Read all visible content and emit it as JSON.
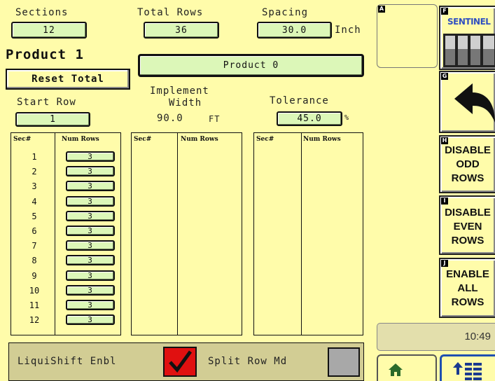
{
  "top": {
    "sections_label": "Sections",
    "sections_value": "12",
    "total_rows_label": "Total Rows",
    "total_rows_value": "36",
    "spacing_label": "Spacing",
    "spacing_value": "30.0",
    "spacing_unit": "Inch"
  },
  "product": {
    "title": "Product 1",
    "selector_value": "Product 0",
    "reset_label": "Reset Total"
  },
  "start_row": {
    "label": "Start Row",
    "value": "1"
  },
  "implement": {
    "label_line1": "Implement",
    "label_line2": "Width",
    "value": "90.0",
    "unit": "FT"
  },
  "tolerance": {
    "label": "Tolerance",
    "value": "45.0",
    "unit": "%"
  },
  "table": {
    "col_sec": "Sec#",
    "col_rows": "Num Rows",
    "rows": [
      {
        "sec": "1",
        "rows": "3"
      },
      {
        "sec": "2",
        "rows": "3"
      },
      {
        "sec": "3",
        "rows": "3"
      },
      {
        "sec": "4",
        "rows": "3"
      },
      {
        "sec": "5",
        "rows": "3"
      },
      {
        "sec": "6",
        "rows": "3"
      },
      {
        "sec": "7",
        "rows": "3"
      },
      {
        "sec": "8",
        "rows": "3"
      },
      {
        "sec": "9",
        "rows": "3"
      },
      {
        "sec": "10",
        "rows": "3"
      },
      {
        "sec": "11",
        "rows": "3"
      },
      {
        "sec": "12",
        "rows": "3"
      }
    ]
  },
  "bottom": {
    "liquishift_label": "LiquiShift Enbl",
    "liquishift_checked": true,
    "split_row_label": "Split Row Md",
    "split_row_checked": false
  },
  "side": {
    "keys": [
      "A",
      "F",
      "G",
      "H",
      "I",
      "J"
    ],
    "sentinel_text": "SENTINEL",
    "disable_odd": [
      "DISABLE",
      "ODD",
      "ROWS"
    ],
    "disable_even": [
      "DISABLE",
      "EVEN",
      "ROWS"
    ],
    "enable_all": [
      "ENABLE",
      "ALL",
      "ROWS"
    ],
    "clock": "10:49"
  },
  "colors": {
    "background": "#fffcaa",
    "field": "#dcf7b8",
    "check": "#e01010",
    "home_icon": "#2a6a2a",
    "menu_button": "#2050b0"
  }
}
